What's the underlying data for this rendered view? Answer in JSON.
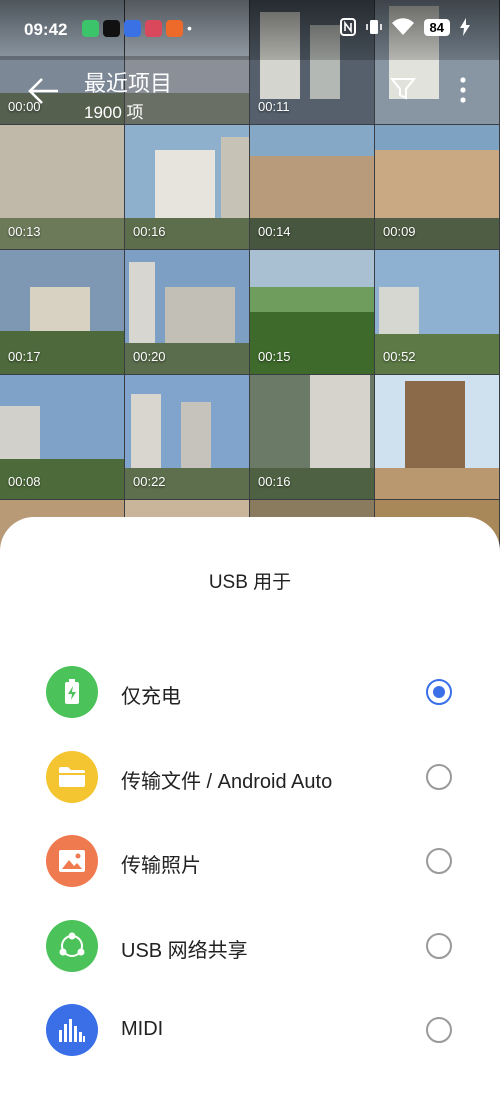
{
  "status_bar": {
    "time": "09:42",
    "dot": "•",
    "battery": "84"
  },
  "header": {
    "title": "最近项目",
    "count": "1900 项"
  },
  "grid": {
    "durations": [
      "00:00",
      "",
      "00:11",
      "",
      "00:13",
      "00:16",
      "00:14",
      "00:09",
      "00:17",
      "00:20",
      "00:15",
      "00:52",
      "00:08",
      "00:22",
      "00:16",
      ""
    ]
  },
  "sheet": {
    "title": "USB 用于",
    "options": [
      {
        "label": "仅充电",
        "icon": "battery-charging-icon",
        "color": "#4cc35a",
        "selected": true
      },
      {
        "label": "传输文件 / Android Auto",
        "icon": "folder-icon",
        "color": "#f5c531",
        "selected": false
      },
      {
        "label": "传输照片",
        "icon": "photo-icon",
        "color": "#f07a4f",
        "selected": false
      },
      {
        "label": "USB 网络共享",
        "icon": "share-network-icon",
        "color": "#4cc35a",
        "selected": false
      },
      {
        "label": "MIDI",
        "icon": "audio-equalizer-icon",
        "color": "#3a6fe8",
        "selected": false
      }
    ]
  }
}
